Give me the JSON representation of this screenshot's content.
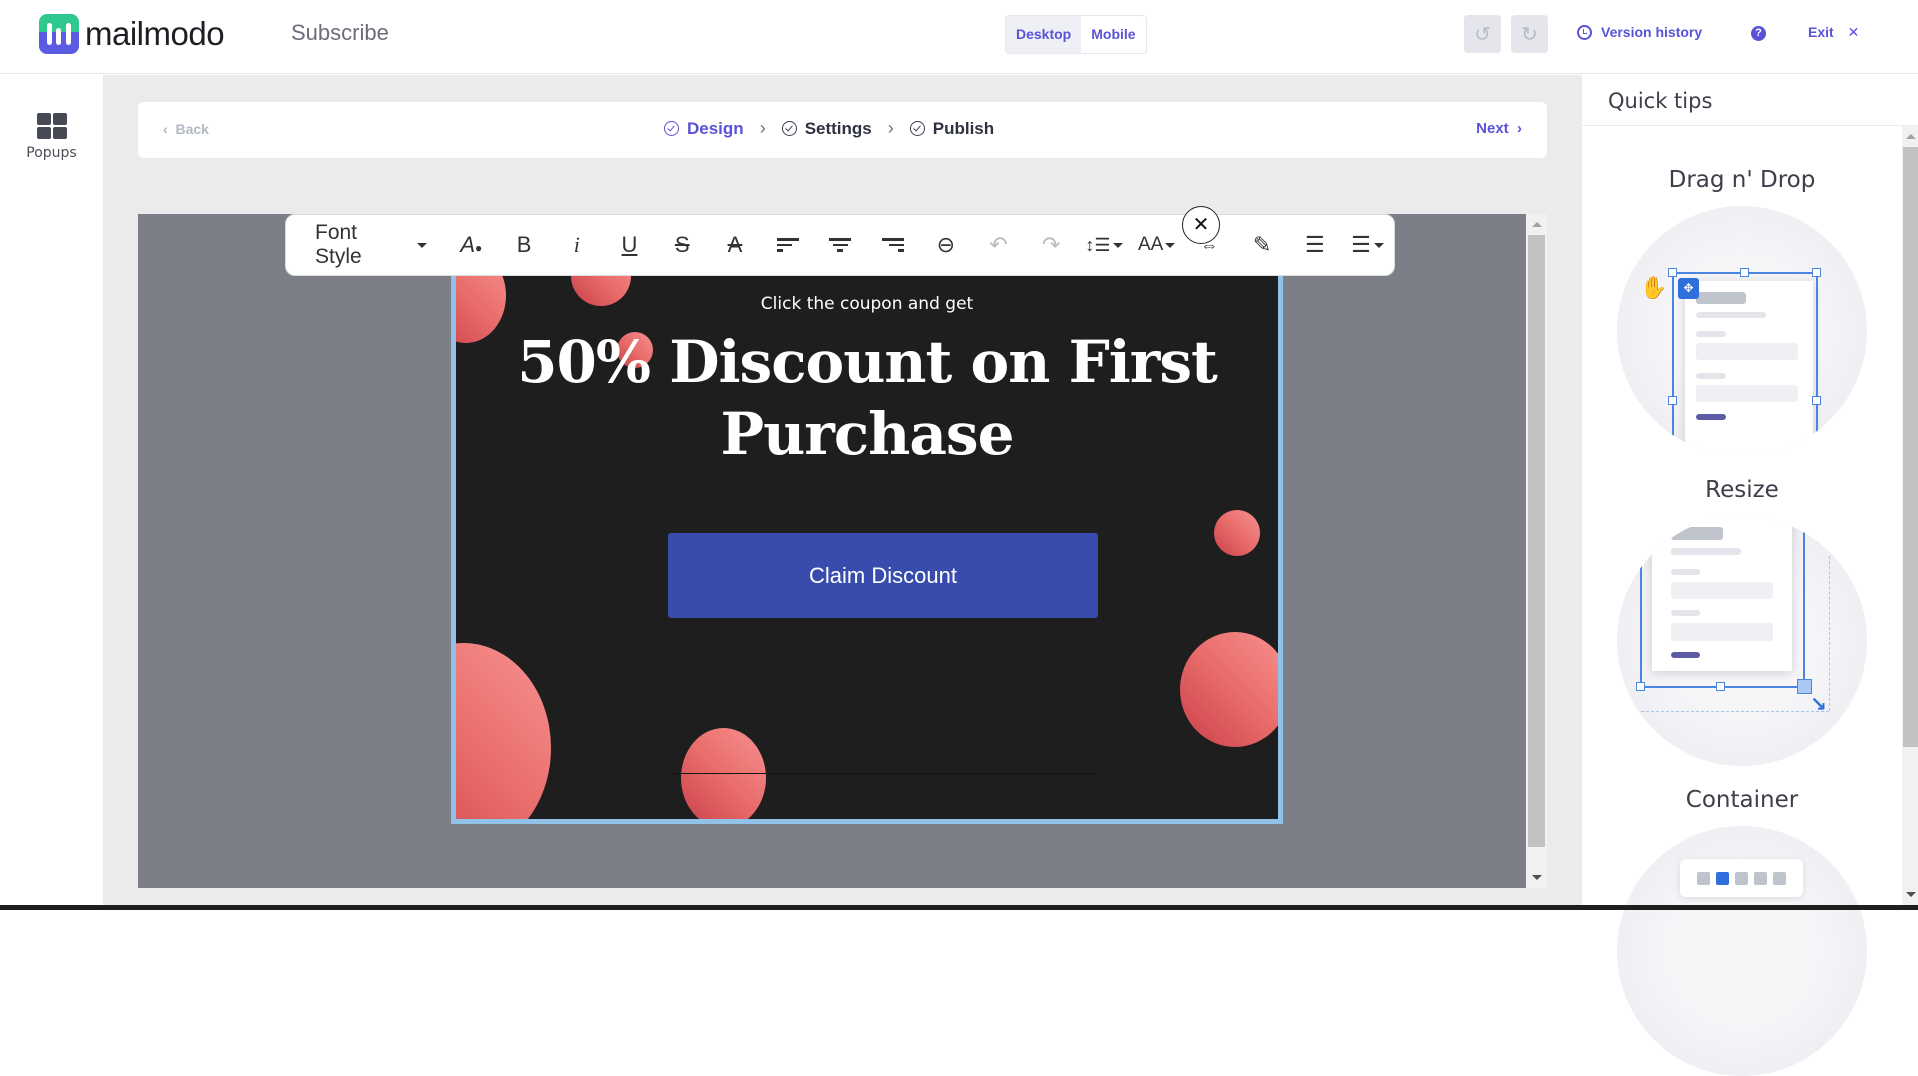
{
  "header": {
    "logo_text": "mailmodo",
    "page_name": "Subscribe",
    "view_modes": [
      "Desktop",
      "Mobile"
    ],
    "active_view": "Desktop",
    "undo_icon": "undo-icon",
    "redo_icon": "redo-icon",
    "version_history_label": "Version history",
    "help_label": "?",
    "exit_label": "Exit",
    "exit_icon": "✕"
  },
  "sidebar": {
    "items": [
      {
        "label": "Popups",
        "icon": "grid-icon"
      }
    ]
  },
  "stepper": {
    "back_label": "Back",
    "steps": [
      {
        "label": "Design",
        "active": true
      },
      {
        "label": "Settings",
        "active": false
      },
      {
        "label": "Publish",
        "active": false
      }
    ],
    "next_label": "Next"
  },
  "toolbar": {
    "font_style_label": "Font Style",
    "buttons": [
      {
        "name": "text-color",
        "glyph": "A"
      },
      {
        "name": "bold",
        "glyph": "B"
      },
      {
        "name": "italic",
        "glyph": "i"
      },
      {
        "name": "underline",
        "glyph": "U"
      },
      {
        "name": "strikethrough",
        "glyph": "S"
      },
      {
        "name": "clear-format",
        "glyph": "A"
      },
      {
        "name": "align-left"
      },
      {
        "name": "align-center"
      },
      {
        "name": "align-right"
      },
      {
        "name": "link",
        "glyph": "⊖"
      },
      {
        "name": "undo",
        "glyph": "↶"
      },
      {
        "name": "redo",
        "glyph": "↷"
      },
      {
        "name": "line-height",
        "glyph": "↕☰"
      },
      {
        "name": "font-size",
        "glyph": "AA"
      },
      {
        "name": "letter-spacing",
        "glyph": "⇔"
      },
      {
        "name": "highlight",
        "glyph": "✎"
      },
      {
        "name": "ordered-list",
        "glyph": "☰"
      },
      {
        "name": "unordered-list",
        "glyph": "☰"
      }
    ],
    "close_glyph": "✕"
  },
  "popup": {
    "subtitle": "Click the coupon and get",
    "headline": "50% Discount on First Purchase",
    "cta_label": "Claim Discount",
    "background_color": "#1e1e1e",
    "cta_color": "#384cad"
  },
  "quick_tips": {
    "title": "Quick tips",
    "tips": [
      {
        "label": "Drag n' Drop"
      },
      {
        "label": "Resize"
      },
      {
        "label": "Container"
      }
    ]
  },
  "colors": {
    "accent": "#5a52d8",
    "selection": "#4a86e0",
    "canvas_bg": "#7c7f88"
  }
}
